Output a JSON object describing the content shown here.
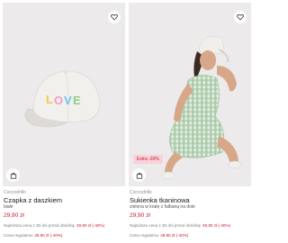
{
  "products": [
    {
      "brand": "Coccodrillo",
      "title": "Czapka z daszkiem",
      "color": "białe",
      "price": "29,90 zł",
      "lowest_label": "Najniższa cena z 30 dni przed obniżką:",
      "lowest_value": "49,90 zł (-40%)",
      "regular_label": "Cena regularna:",
      "regular_value": "49,90 zł (-40%)",
      "image_text": "LOVE",
      "icons": {
        "favorite": "heart-icon",
        "cart": "shopping-bag-icon"
      }
    },
    {
      "brand": "Coccodrillo",
      "title": "Sukienka tkaninowa",
      "color": "zielona w kratę z falbaną na dole",
      "price": "29,90 zł",
      "badge": "Extra -20%",
      "lowest_label": "Najniższa cena z 30 dni przed obniżką:",
      "lowest_value": "49,90 zł (-40%)",
      "regular_label": "Cena regularna:",
      "regular_value": "49,90 zł (-40%)",
      "icons": {
        "favorite": "heart-icon",
        "cart": "shopping-bag-icon"
      }
    }
  ],
  "colors": {
    "sale": "#c6182f",
    "badge_bg": "#f8d2da",
    "image_bg": "#eceaea"
  }
}
